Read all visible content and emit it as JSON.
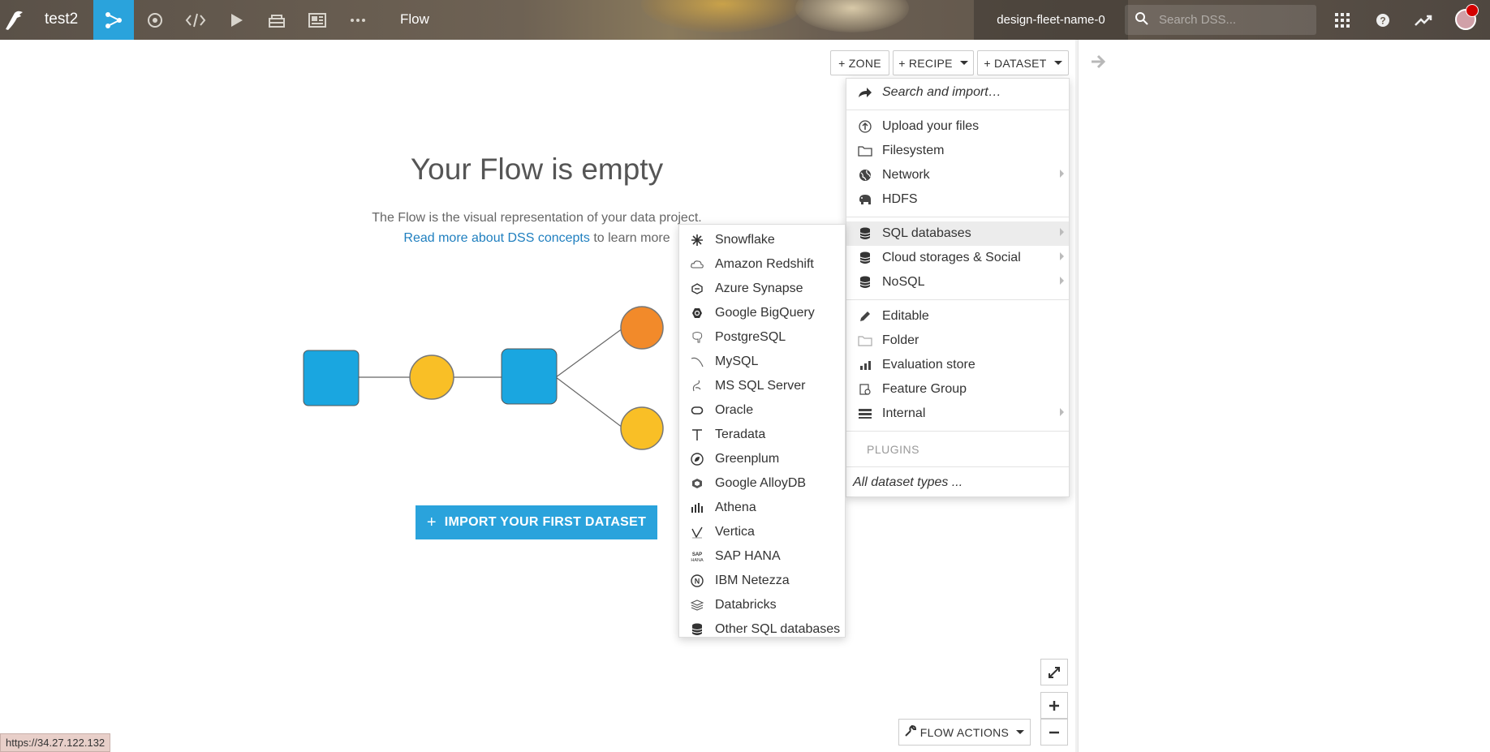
{
  "topbar": {
    "project_name": "test2",
    "flow_label": "Flow",
    "instance_name": "design-fleet-name-0",
    "search_placeholder": "Search DSS..."
  },
  "toolbar": {
    "zone_label": "+ ZONE",
    "recipe_label": "+ RECIPE",
    "dataset_label": "+ DATASET"
  },
  "empty_state": {
    "title": "Your Flow is empty",
    "description": "The Flow is the visual representation of your data project.",
    "link_text": "Read more about DSS concepts",
    "link_suffix": " to learn more",
    "import_button": "IMPORT YOUR FIRST DATASET"
  },
  "dataset_menu": {
    "search_import": "Search and import…",
    "upload_files": "Upload your files",
    "filesystem": "Filesystem",
    "network": "Network",
    "hdfs": "HDFS",
    "sql_databases": "SQL databases",
    "cloud_storages": "Cloud storages & Social",
    "nosql": "NoSQL",
    "editable": "Editable",
    "folder": "Folder",
    "evaluation_store": "Evaluation store",
    "feature_group": "Feature Group",
    "internal": "Internal",
    "plugins_header": "PLUGINS",
    "all_types": "All dataset types ..."
  },
  "sql_submenu": [
    {
      "label": "Snowflake",
      "icon": "snowflake-icon"
    },
    {
      "label": "Amazon Redshift",
      "icon": "redshift-icon"
    },
    {
      "label": "Azure Synapse",
      "icon": "synapse-icon"
    },
    {
      "label": "Google BigQuery",
      "icon": "bigquery-icon"
    },
    {
      "label": "PostgreSQL",
      "icon": "postgresql-icon"
    },
    {
      "label": "MySQL",
      "icon": "mysql-icon"
    },
    {
      "label": "MS SQL Server",
      "icon": "mssql-icon"
    },
    {
      "label": "Oracle",
      "icon": "oracle-icon"
    },
    {
      "label": "Teradata",
      "icon": "teradata-icon"
    },
    {
      "label": "Greenplum",
      "icon": "greenplum-icon"
    },
    {
      "label": "Google AlloyDB",
      "icon": "alloydb-icon"
    },
    {
      "label": "Athena",
      "icon": "athena-icon"
    },
    {
      "label": "Vertica",
      "icon": "vertica-icon"
    },
    {
      "label": "SAP HANA",
      "icon": "sap-hana-icon"
    },
    {
      "label": "IBM Netezza",
      "icon": "netezza-icon"
    },
    {
      "label": "Databricks",
      "icon": "databricks-icon"
    },
    {
      "label": "Other SQL databases",
      "icon": "database-icon"
    }
  ],
  "bottom": {
    "flow_actions": "FLOW ACTIONS",
    "status_url": "https://34.27.122.132"
  },
  "colors": {
    "accent": "#2aa3dc",
    "flow_orange": "#f28a2a",
    "flow_yellow": "#f9bf26",
    "flow_blue": "#1aa6e0"
  }
}
